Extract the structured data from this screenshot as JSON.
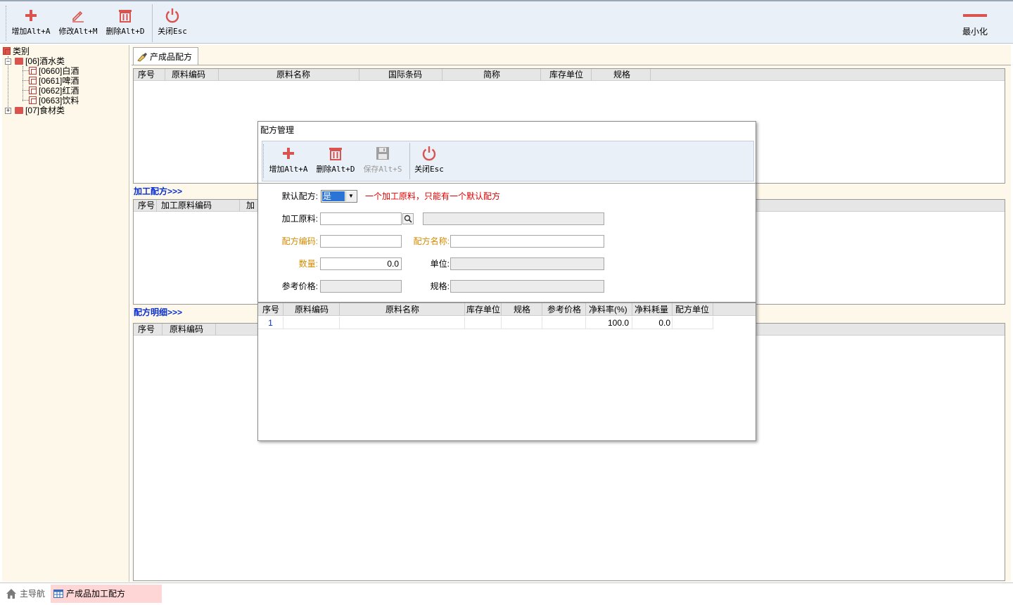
{
  "toolbar": {
    "add_label": "增加Alt+A",
    "edit_label": "修改Alt+M",
    "delete_label": "删除Alt+D",
    "close_label": "关闭Esc",
    "minimize_label": "最小化"
  },
  "tree": {
    "root": "类别",
    "nodes": [
      {
        "label": "[06]酒水类"
      },
      {
        "label": "[0660]白酒"
      },
      {
        "label": "[0661]啤酒"
      },
      {
        "label": "[0662]红酒"
      },
      {
        "label": "[0663]饮料"
      },
      {
        "label": "[07]食材类"
      }
    ]
  },
  "main": {
    "tab_label": "产成品配方",
    "top_grid": {
      "columns": [
        "序号",
        "原料编码",
        "原料名称",
        "国际条码",
        "简称",
        "库存单位",
        "规格"
      ]
    },
    "processing_section": "加工配方>>>",
    "processing_grid": {
      "columns": [
        "序号",
        "加工原料编码",
        "加"
      ]
    },
    "detail_section": "配方明细>>>",
    "detail_grid": {
      "columns": [
        "序号",
        "原料编码"
      ]
    }
  },
  "dialog": {
    "title": "配方管理",
    "toolbar": {
      "add_label": "增加Alt+A",
      "delete_label": "删除Alt+D",
      "save_label": "保存Alt+S",
      "close_label": "关闭Esc"
    },
    "form": {
      "default_label": "默认配方:",
      "default_value": "是",
      "default_hint": "一个加工原料，只能有一个默认配方",
      "material_label": "加工原料:",
      "material_value": "",
      "material_name_value": "",
      "code_label": "配方编码:",
      "code_value": "",
      "name_label": "配方名称:",
      "name_value": "",
      "qty_label": "数量:",
      "qty_value": "0.0",
      "unit_label": "单位:",
      "unit_value": "",
      "price_label": "参考价格:",
      "price_value": "",
      "spec_label": "规格:",
      "spec_value": ""
    },
    "grid": {
      "columns": [
        "序号",
        "原料编码",
        "原料名称",
        "库存单位",
        "规格",
        "参考价格",
        "净料率(%)",
        "净料耗量",
        "配方单位"
      ],
      "rows": [
        {
          "no": "1",
          "code": "",
          "name": "",
          "unit": "",
          "spec": "",
          "price": "",
          "rate": "100.0",
          "consume": "0.0",
          "recipe_unit": ""
        }
      ]
    }
  },
  "bottom": {
    "home_label": "主导航",
    "active_tab": "产成品加工配方"
  },
  "colors": {
    "accent_red": "#d9534f",
    "section_blue": "#0a2fd1",
    "hint_red": "#e00000",
    "label_orange": "#d58a00"
  }
}
